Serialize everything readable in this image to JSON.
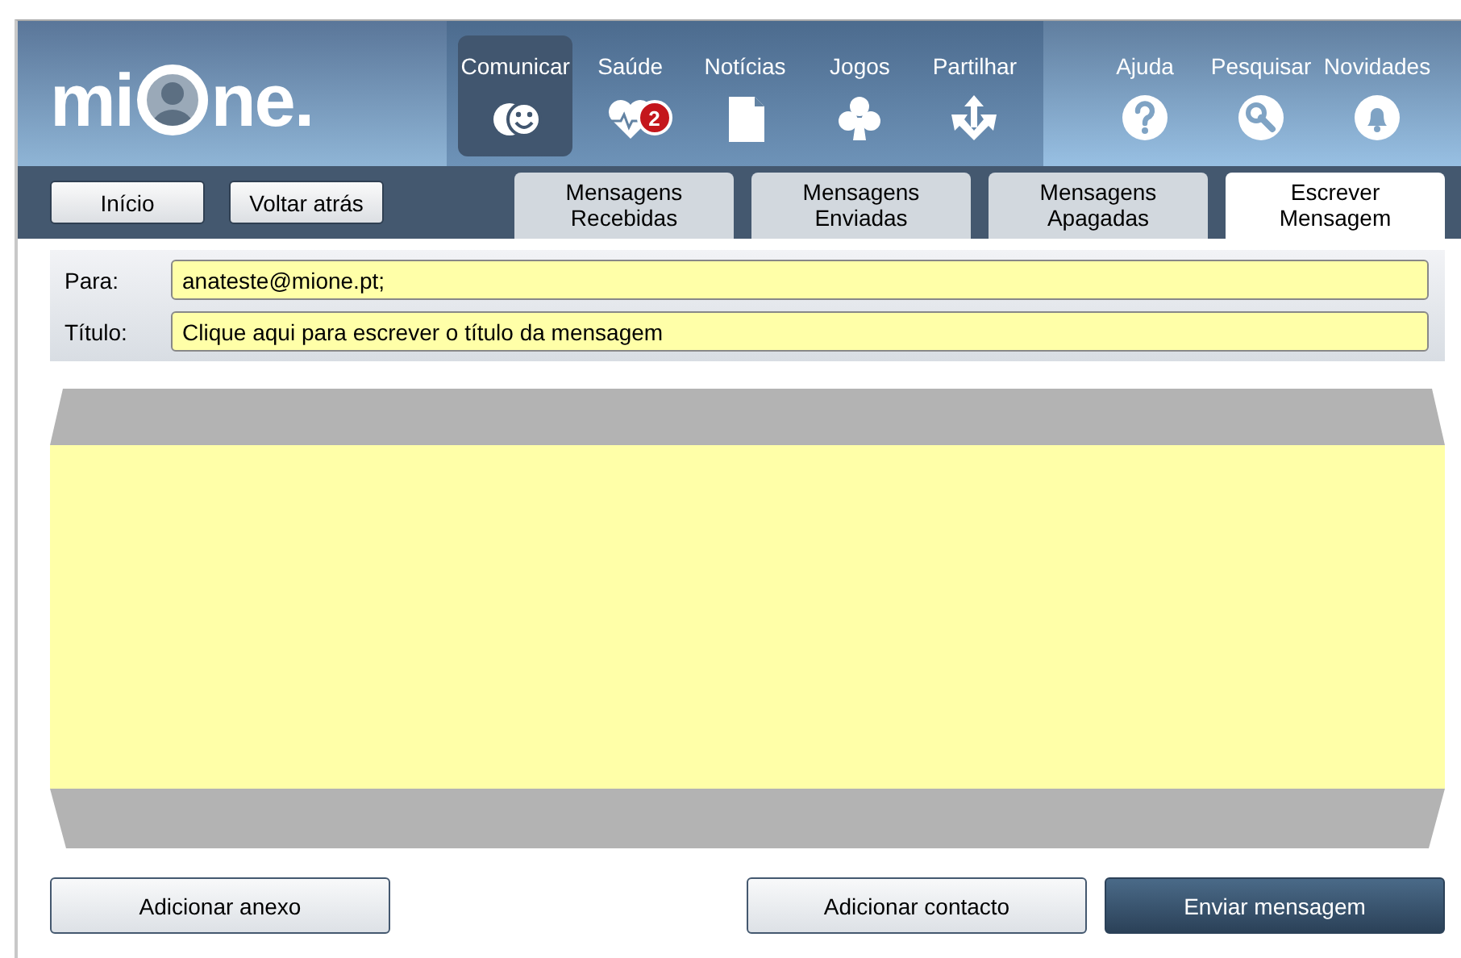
{
  "logo": {
    "before": "mi",
    "after": "ne."
  },
  "nav_main": [
    {
      "label": "Comunicar",
      "selected": true
    },
    {
      "label": "Saúde",
      "selected": false,
      "badge": "2"
    },
    {
      "label": "Notícias",
      "selected": false
    },
    {
      "label": "Jogos",
      "selected": false
    },
    {
      "label": "Partilhar",
      "selected": false
    }
  ],
  "nav_help": [
    {
      "label": "Ajuda",
      "selected": false
    },
    {
      "label": "Pesquisar",
      "selected": false
    },
    {
      "label": "Novidades",
      "selected": false
    }
  ],
  "toolbar_buttons": [
    "Início",
    "Voltar atrás"
  ],
  "tabs": [
    {
      "label": "Mensagens Recebidas",
      "selected": false
    },
    {
      "label": "Mensagens Enviadas",
      "selected": false
    },
    {
      "label": "Mensagens Apagadas",
      "selected": false
    },
    {
      "label": "Escrever Mensagem",
      "selected": true
    }
  ],
  "form": [
    {
      "label": "Para:",
      "value": "anateste@mione.pt;"
    },
    {
      "label": "Título:",
      "placeholder": "Clique aqui para escrever o título da mensagem"
    }
  ],
  "actions": [
    {
      "label": "Adicionar anexo",
      "kind": "secondary"
    },
    {
      "label": "Adicionar contacto",
      "kind": "secondary"
    },
    {
      "label": "Enviar mensagem",
      "kind": "primary"
    }
  ]
}
